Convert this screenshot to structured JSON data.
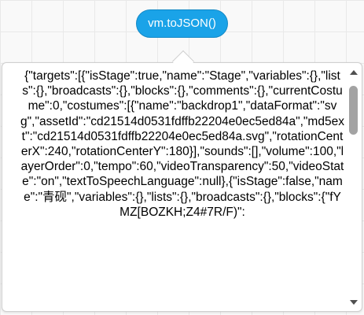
{
  "block": {
    "label": "vm.toJSON()",
    "color": "#1aa3e8"
  },
  "bubble": {
    "text": "{\"targets\":[{\"isStage\":true,\"name\":\"Stage\",\"variables\":{},\"lists\":{},\"broadcasts\":{},\"blocks\":{},\"comments\":{},\"currentCostume\":0,\"costumes\":[{\"name\":\"backdrop1\",\"dataFormat\":\"svg\",\"assetId\":\"cd21514d0531fdffb22204e0ec5ed84a\",\"md5ext\":\"cd21514d0531fdffb22204e0ec5ed84a.svg\",\"rotationCenterX\":240,\"rotationCenterY\":180}],\"sounds\":[],\"volume\":100,\"layerOrder\":0,\"tempo\":60,\"videoTransparency\":50,\"videoState\":\"on\",\"textToSpeechLanguage\":null},{\"isStage\":false,\"name\":\"青砚\",\"variables\":{},\"lists\":{},\"broadcasts\":{},\"blocks\":{\"fYMZ[BOZKH;Z4#7R/F)\":"
  },
  "icons": {
    "scroll_up": "triangle-up-icon",
    "scroll_down": "triangle-down-icon"
  }
}
